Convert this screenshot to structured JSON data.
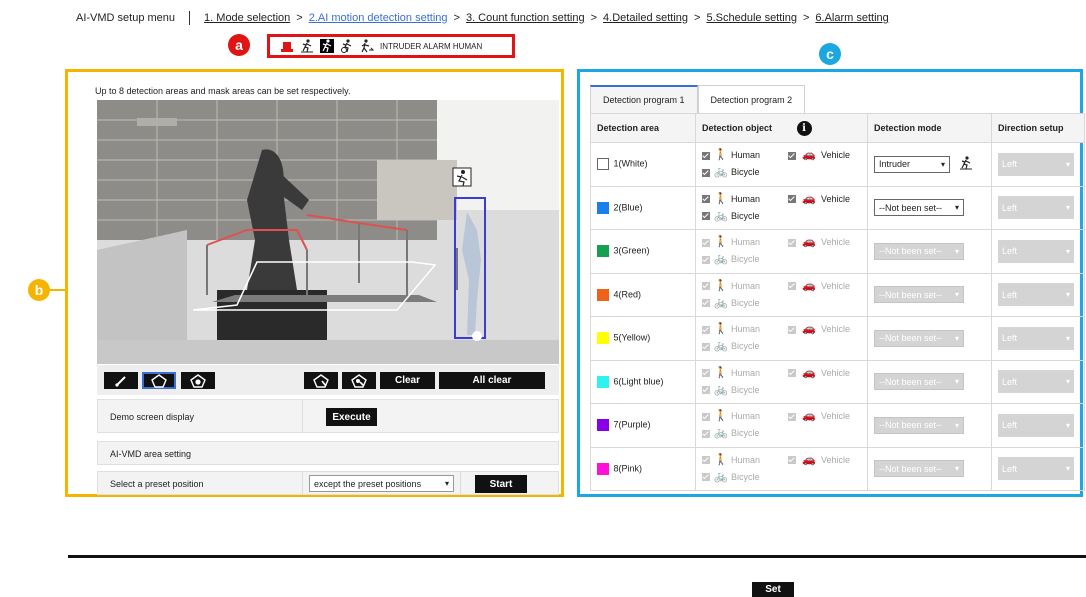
{
  "nav": {
    "app_title": "AI-VMD setup menu",
    "steps": [
      {
        "label": "1. Mode selection"
      },
      {
        "label": "2.AI motion detection setting"
      },
      {
        "label": "3. Count function setting"
      },
      {
        "label": "4.Detailed setting"
      },
      {
        "label": "5.Schedule setting"
      },
      {
        "label": "6.Alarm setting"
      }
    ],
    "separator": ">"
  },
  "callouts": {
    "a": "a",
    "b": "b",
    "c": "c"
  },
  "status": {
    "text": "INTRUDER ALARM HUMAN"
  },
  "left_panel": {
    "description": "Up to 8 detection areas and mask areas can be set respectively.",
    "toolbar": {
      "clear_label": "Clear",
      "all_clear_label": "All clear"
    },
    "demo": {
      "label": "Demo screen display",
      "button_label": "Execute"
    },
    "area_setting": {
      "label": "AI-VMD area setting"
    },
    "preset": {
      "label": "Select a preset position",
      "value": "except the preset positions",
      "button_label": "Start"
    }
  },
  "right_panel": {
    "tabs": [
      {
        "label": "Detection program 1"
      },
      {
        "label": "Detection program 2"
      }
    ],
    "headers": {
      "area": "Detection area",
      "object": "Detection object",
      "mode": "Detection mode",
      "direction": "Direction setup"
    },
    "object_labels": {
      "human": "Human",
      "vehicle": "Vehicle",
      "bicycle": "Bicycle"
    },
    "rows": [
      {
        "area": "1(White)",
        "color": "#ffffff",
        "mode": "Intruder",
        "direction": "Left"
      },
      {
        "area": "2(Blue)",
        "color": "#1a7fe8",
        "mode": "--Not been set--",
        "direction": "Left"
      },
      {
        "area": "3(Green)",
        "color": "#14a050",
        "mode": "--Not been set--",
        "direction": "Left"
      },
      {
        "area": "4(Red)",
        "color": "#f0621a",
        "mode": "--Not been set--",
        "direction": "Left"
      },
      {
        "area": "5(Yellow)",
        "color": "#ffff00",
        "mode": "--Not been set--",
        "direction": "Left"
      },
      {
        "area": "6(Light blue)",
        "color": "#2ef2f2",
        "mode": "--Not been set--",
        "direction": "Left"
      },
      {
        "area": "7(Purple)",
        "color": "#8a00e6",
        "mode": "--Not been set--",
        "direction": "Left"
      },
      {
        "area": "8(Pink)",
        "color": "#ff10d8",
        "mode": "--Not been set--",
        "direction": "Left"
      }
    ]
  },
  "footer": {
    "set_label": "Set"
  }
}
